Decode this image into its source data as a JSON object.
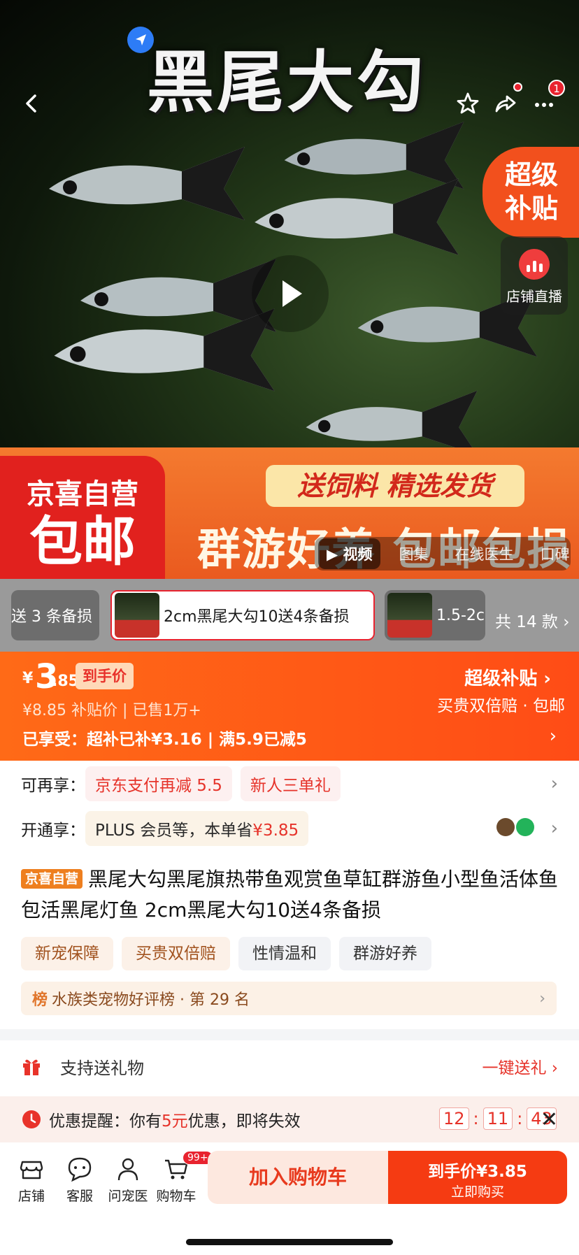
{
  "hero": {
    "title": "黑尾大勾",
    "more_badge": "1",
    "side_super": "超级补贴",
    "side_live": "店铺直播",
    "promo_left_top": "京喜自营",
    "promo_left_big": "包邮",
    "promo_ribbon": "送饲料 精选发货",
    "promo_big": "群游好养 包邮包损",
    "media_tabs": [
      "视频",
      "图集",
      "在线医生",
      "口碑"
    ]
  },
  "sku": {
    "items": [
      "送 3 条备损",
      "2cm黑尾大勾10送4条备损",
      "1.5-2c"
    ],
    "total": "共 14 款"
  },
  "price": {
    "currency": "¥",
    "int": "3",
    "dec": ".85",
    "tag": "到手价",
    "sub": "¥8.85  补贴价 | 已售1万+",
    "enjoy": "已享受：超补已补¥3.16 | 满5.9已减5",
    "right_title": "超级补贴",
    "right_sub": "买贵双倍赔 · 包邮"
  },
  "extra": {
    "label1": "可再享：",
    "pills1": [
      "京东支付再减 5.5",
      "新人三单礼"
    ],
    "label2": "开通享：",
    "plus_text": "PLUS 会员等，本单省",
    "plus_save": "¥3.85"
  },
  "product": {
    "badge": "京喜自营",
    "title": "黑尾大勾黑尾旗热带鱼观赏鱼草缸群游鱼小型鱼活体鱼包活黑尾灯鱼 2cm黑尾大勾10送4条备损",
    "tags": [
      "新宠保障",
      "买贵双倍赔",
      "性情温和",
      "群游好养"
    ],
    "rank_key": "榜",
    "rank_text": "水族类宠物好评榜 · 第 29 名"
  },
  "gift": {
    "label": "支持送礼物",
    "action": "一键送礼"
  },
  "remind": {
    "prefix": "优惠提醒：你有",
    "amount": "5元",
    "suffix": "优惠，即将失效",
    "h": "12",
    "m": "11",
    "s": "43"
  },
  "bottom": {
    "items": [
      "店铺",
      "客服",
      "问宠医",
      "购物车"
    ],
    "cart_badge": "99+",
    "add_cart": "加入购物车",
    "buy_top": "到手价¥3.85",
    "buy_bottom": "立即购买"
  },
  "colors": {
    "accent": "#f53b12",
    "brand_red": "#e8232f",
    "price_band": "#ff5a17"
  }
}
